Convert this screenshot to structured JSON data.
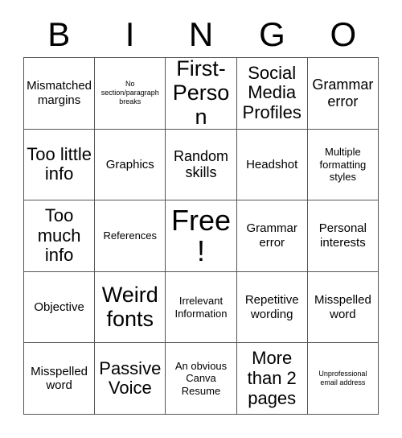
{
  "card": {
    "header_letters": [
      "B",
      "I",
      "N",
      "G",
      "O"
    ],
    "columns": 5,
    "rows": 5,
    "free_space": {
      "row": 3,
      "column": 3,
      "label": "Free!"
    },
    "colors": {
      "background": "#ffffff",
      "text": "#000000",
      "grid_line": "#555555"
    },
    "cells": [
      [
        {
          "text": "Mismatched margins",
          "size": "md"
        },
        {
          "text": "No section/paragraph breaks",
          "size": "xs"
        },
        {
          "text": "First-Person",
          "size": "xxl"
        },
        {
          "text": "Social Media Profiles",
          "size": "xl"
        },
        {
          "text": "Grammar error",
          "size": "lg"
        }
      ],
      [
        {
          "text": "Too little info",
          "size": "xl"
        },
        {
          "text": "Graphics",
          "size": "md"
        },
        {
          "text": "Random skills",
          "size": "lg"
        },
        {
          "text": "Headshot",
          "size": "md"
        },
        {
          "text": "Multiple formatting styles",
          "size": "sm"
        }
      ],
      [
        {
          "text": "Too much info",
          "size": "xl"
        },
        {
          "text": "References",
          "size": "sm"
        },
        {
          "text": "Free!",
          "size": "free"
        },
        {
          "text": "Grammar error",
          "size": "md"
        },
        {
          "text": "Personal interests",
          "size": "md"
        }
      ],
      [
        {
          "text": "Objective",
          "size": "md"
        },
        {
          "text": "Weird fonts",
          "size": "xxl"
        },
        {
          "text": "Irrelevant Information",
          "size": "sm"
        },
        {
          "text": "Repetitive wording",
          "size": "md"
        },
        {
          "text": "Misspelled word",
          "size": "md"
        }
      ],
      [
        {
          "text": "Misspelled word",
          "size": "md"
        },
        {
          "text": "Passive Voice",
          "size": "xl"
        },
        {
          "text": "An obvious Canva Resume",
          "size": "sm"
        },
        {
          "text": "More than 2 pages",
          "size": "xl"
        },
        {
          "text": "Unprofessional email address",
          "size": "xs"
        }
      ]
    ]
  }
}
